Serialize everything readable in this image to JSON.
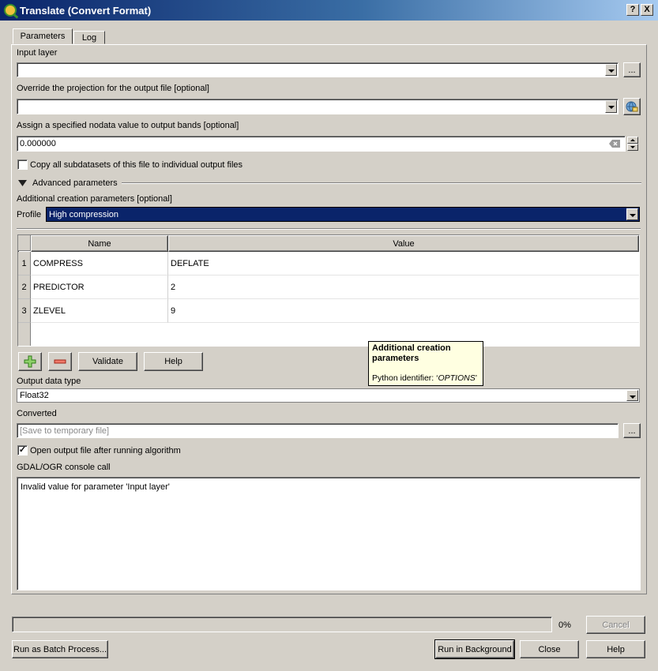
{
  "window": {
    "title": "Translate (Convert Format)",
    "help_btn": "?",
    "close_btn": "X"
  },
  "tabs": [
    {
      "label": "Parameters"
    },
    {
      "label": "Log"
    }
  ],
  "input_layer": {
    "label": "Input layer",
    "value": "",
    "browse": "..."
  },
  "projection": {
    "label": "Override the projection for the output file [optional]",
    "value": ""
  },
  "nodata": {
    "label": "Assign a specified nodata value to output bands [optional]",
    "value": "0.000000"
  },
  "copy_subdatasets": {
    "label": "Copy all subdatasets of this file to individual output files",
    "checked": false
  },
  "advanced": {
    "label": "Advanced parameters"
  },
  "creation_params": {
    "label": "Additional creation parameters [optional]",
    "profile_label": "Profile",
    "profile_value": "High compression",
    "columns": [
      "Name",
      "Value"
    ],
    "rows": [
      {
        "num": "1",
        "name": "COMPRESS",
        "value": "DEFLATE"
      },
      {
        "num": "2",
        "name": "PREDICTOR",
        "value": "2"
      },
      {
        "num": "3",
        "name": "ZLEVEL",
        "value": "9"
      }
    ],
    "validate": "Validate",
    "help": "Help"
  },
  "tooltip": {
    "title": "Additional creation parameters",
    "prefix": "Python identifier: ‘",
    "identifier": "OPTIONS",
    "suffix": "’"
  },
  "output_type": {
    "label": "Output data type",
    "value": "Float32"
  },
  "converted": {
    "label": "Converted",
    "placeholder": "[Save to temporary file]",
    "browse": "..."
  },
  "open_output": {
    "label": "Open output file after running algorithm",
    "checked": true,
    "mark": "✓"
  },
  "console": {
    "label": "GDAL/OGR console call",
    "text": "Invalid value for parameter 'Input layer'"
  },
  "progress": {
    "percent_text": "0%",
    "value": 0
  },
  "buttons": {
    "cancel": "Cancel",
    "batch": "Run as Batch Process...",
    "background": "Run in Background",
    "close": "Close",
    "help": "Help"
  },
  "colors": {
    "selection": "#0a246a",
    "window_bg": "#d4d0c8",
    "tooltip_bg": "#ffffe1"
  }
}
